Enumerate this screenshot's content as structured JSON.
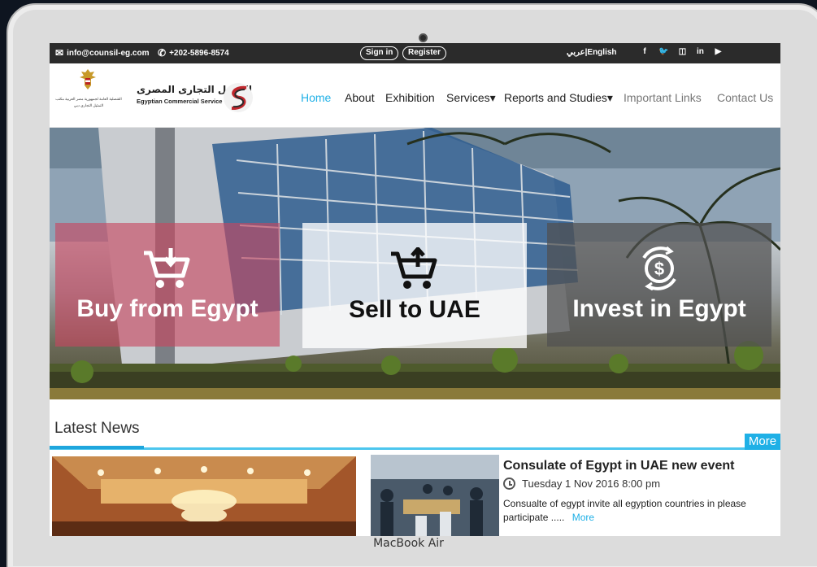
{
  "device": {
    "label": "MacBook Air"
  },
  "topbar": {
    "email": "info@counsil-eg.com",
    "phone": "+202-5896-8574",
    "signin_label": "Sign in",
    "register_label": "Register",
    "language": "عربي|English",
    "social": [
      "f",
      "t",
      "ig",
      "in",
      "yt"
    ]
  },
  "brand": {
    "arabic_name": "التمثيل التجارى المصرى",
    "english_name": "Egyptian Commercial Service",
    "emblem_text": "القنصلية العامة لجمهورية مصر العربية مكتب التمثيل التجاري دبي"
  },
  "nav": {
    "items": [
      {
        "label": "Home",
        "active": true
      },
      {
        "label": "About"
      },
      {
        "label": "Exhibition"
      },
      {
        "label": "Services▾"
      },
      {
        "label": "Reports and Studies▾"
      },
      {
        "label": "Important Links"
      },
      {
        "label": "Contact Us"
      }
    ]
  },
  "hero": {
    "cards": [
      {
        "label": "Buy from Egypt",
        "icon": "cart-download-icon"
      },
      {
        "label": "Sell to UAE",
        "icon": "cart-upload-icon"
      },
      {
        "label": "Invest in Egypt",
        "icon": "dollar-cycle-icon"
      }
    ]
  },
  "news": {
    "section_title": "Latest News",
    "more_label": "More",
    "item": {
      "headline": "Consulate of Egypt in UAE new event",
      "date": "Tuesday 1 Nov 2016 8:00 pm",
      "excerpt": "Consualte of egypt invite all egyption countries in please participate .....",
      "more_label": "More"
    }
  },
  "colors": {
    "accent": "#1fb0e6",
    "topbar": "#2b2b2b",
    "buy_card": "#c8465f",
    "invest_card": "#505050"
  }
}
